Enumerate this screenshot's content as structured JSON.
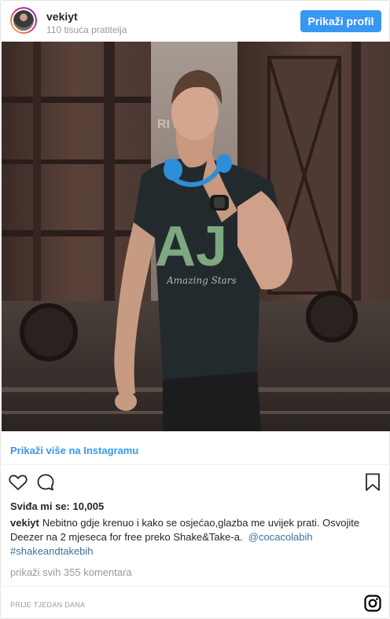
{
  "header": {
    "username": "vekiyt",
    "followers": "110 tisuća pratitelja",
    "profile_button": "Prikaži profil"
  },
  "post": {
    "more_link": "Prikaži više na Instagramu",
    "likes": "Sviđa mi se: 10,005",
    "caption": {
      "username": "vekiyt",
      "text": "Nebitno gdje krenuo i kako se osjećao,glazba me uvijek prati. Osvojite Deezer na 2 mjeseca for free preko Shake&Take-a.",
      "mention": "@cocacolabih",
      "hashtag": "#shakeandtakebih"
    },
    "comments_link": "prikaži svih 355 komentara",
    "timestamp": "PRIJE TJEDAN DANA"
  },
  "photo": {
    "shirt_print": "AJ",
    "shirt_script": "Amazing Stars",
    "wagon_letters": "RI BH"
  },
  "icons": {
    "like": "heart-icon",
    "comment": "comment-icon",
    "save": "bookmark-icon",
    "brand": "instagram-icon"
  },
  "colors": {
    "accent": "#3897f0",
    "tag": "#3f729b",
    "muted": "#999999"
  }
}
